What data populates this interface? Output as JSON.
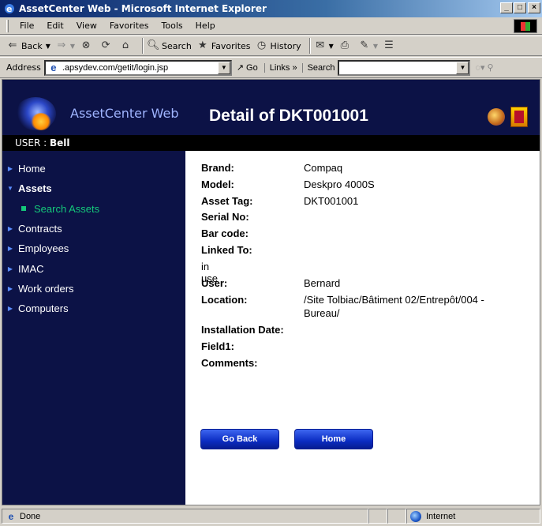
{
  "window": {
    "title": "AssetCenter Web - Microsoft Internet Explorer",
    "buttons": {
      "minimize": "_",
      "maximize": "□",
      "close": "×"
    }
  },
  "menu": [
    "File",
    "Edit",
    "View",
    "Favorites",
    "Tools",
    "Help"
  ],
  "toolbar": {
    "back": "Back",
    "search": "Search",
    "favorites": "Favorites",
    "history": "History"
  },
  "addressbar": {
    "label": "Address",
    "url": ".apsydev.com/getit/login.jsp",
    "go": "Go",
    "links": "Links »",
    "search_label": "Search",
    "search_value": ""
  },
  "header": {
    "brand": "AssetCenter Web",
    "title": "Detail of DKT001001"
  },
  "user": {
    "label": "USER : ",
    "name": "Bell"
  },
  "sidebar": {
    "items": [
      {
        "label": "Home",
        "expanded": false
      },
      {
        "label": "Assets",
        "expanded": true
      },
      {
        "label": "Contracts",
        "expanded": false
      },
      {
        "label": "Employees",
        "expanded": false
      },
      {
        "label": "IMAC",
        "expanded": false
      },
      {
        "label": "Work orders",
        "expanded": false
      },
      {
        "label": "Computers",
        "expanded": false
      }
    ],
    "sub_item": "Search Assets"
  },
  "detail": {
    "brand": {
      "label": "Brand:",
      "value": "Compaq"
    },
    "model": {
      "label": "Model:",
      "value": "Deskpro 4000S"
    },
    "asset_tag": {
      "label": "Asset Tag:",
      "value": "DKT001001"
    },
    "serial": {
      "label": "Serial No:",
      "value": ""
    },
    "barcode": {
      "label": "Bar code:",
      "value": ""
    },
    "linked": {
      "label": "Linked To:",
      "value": ""
    },
    "status": "in use",
    "user": {
      "label": "User:",
      "value": "Bernard"
    },
    "location": {
      "label": "Location:",
      "value_line1": "/Site Tolbiac/Bâtiment 02/Entrepôt/004 -",
      "value_line2": "Bureau/"
    },
    "install_date": {
      "label": "Installation Date:",
      "value": ""
    },
    "field1": {
      "label": "Field1:",
      "value": ""
    },
    "comments": {
      "label": "Comments:",
      "value": ""
    }
  },
  "buttons": {
    "go_back": "Go Back",
    "home": "Home"
  },
  "statusbar": {
    "text": "Done",
    "zone": "Internet"
  },
  "colors": {
    "nav_bg": "#0c1246",
    "accent_green": "#14c87a",
    "button_blue": "#0b2cc2"
  }
}
